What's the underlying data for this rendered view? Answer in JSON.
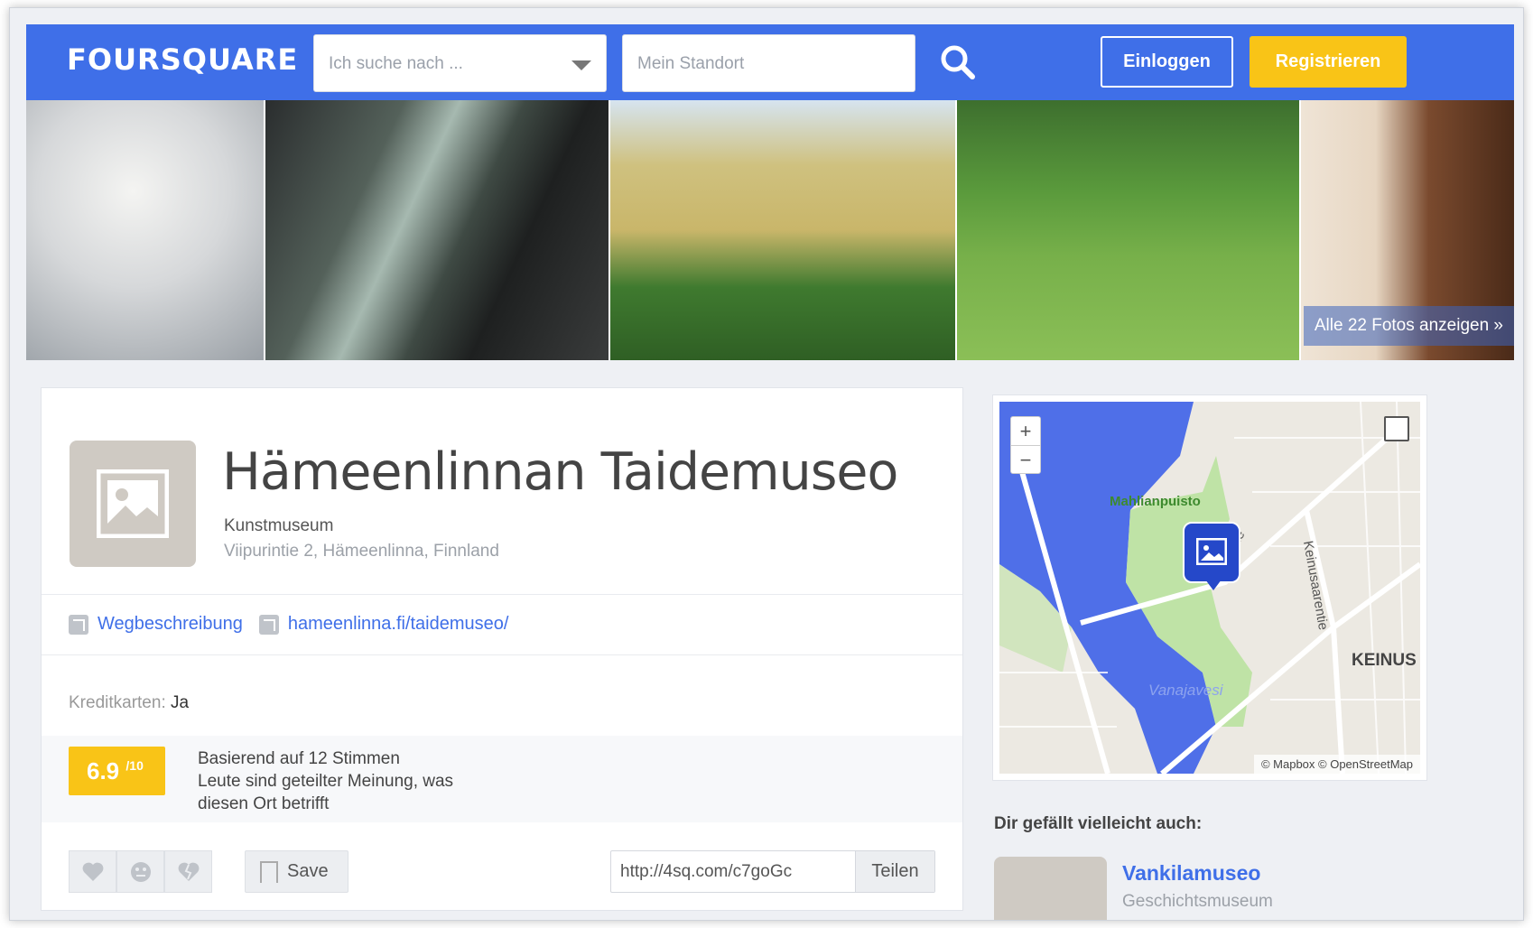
{
  "header": {
    "logo": "FOURSQUARE",
    "search_placeholder": "Ich suche nach ...",
    "location_placeholder": "Mein Standort",
    "login_label": "Einloggen",
    "register_label": "Registrieren",
    "brand_color": "#3f6fe8",
    "accent_color": "#f9c417"
  },
  "photos": {
    "all_photos_label": "Alle 22 Fotos anzeigen »"
  },
  "venue": {
    "name": "Hämeenlinnan Taidemuseo",
    "category": "Kunstmuseum",
    "address": "Viipurintie 2, Hämeenlinna, Finnland",
    "directions_label": "Wegbeschreibung",
    "website": "hameenlinna.fi/taidemuseo/",
    "credit_cards_label": "Kreditkarten:",
    "credit_cards_value": "Ja",
    "score": "6.9",
    "score_max": "/10",
    "rating_lines": [
      "Basierend auf 12 Stimmen",
      "Leute sind geteilter Meinung, was diesen Ort betrifft"
    ],
    "save_label": "Save",
    "share_url": "http://4sq.com/c7goGc",
    "share_label": "Teilen"
  },
  "map": {
    "zoom_in": "+",
    "zoom_out": "−",
    "label_park": "Mahlianpuisto",
    "label_street1": "Keinusaarentie",
    "label_street2": "ntie",
    "label_area": "KEINUS",
    "label_lake": "Vanajavesi",
    "copyright": "© Mapbox © OpenStreetMap"
  },
  "suggestions": {
    "title": "Dir gefällt vielleicht auch:",
    "items": [
      {
        "name": "Vankilamuseo",
        "category": "Geschichtsmuseum"
      }
    ]
  }
}
